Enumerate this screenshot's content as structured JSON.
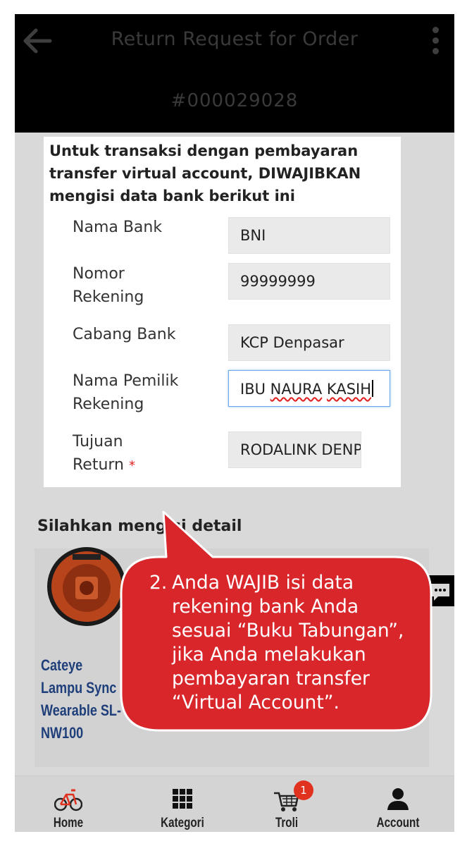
{
  "header": {
    "back_icon": "arrow-left-icon",
    "title": "Return Request for Order",
    "order_number": "#000029028",
    "menu_icon": "kebab-menu-icon"
  },
  "modal": {
    "notice": "Untuk transaksi dengan pembayaran transfer virtual account, DIWAJIBKAN mengisi data bank berikut ini",
    "fields": [
      {
        "label": "Nama Bank",
        "value": "BNI"
      },
      {
        "label": "Nomor Rekening",
        "value": "99999999"
      },
      {
        "label": "Cabang Bank",
        "value": "KCP Denpasar"
      },
      {
        "label": "Nama Pemilik Rekening",
        "value_word1": "IBU",
        "value_word2": "NAURA",
        "value_word3": "KASIH"
      },
      {
        "label": "Tujuan Return",
        "required_mark": "*",
        "value": "RODALINK DENPASAR"
      }
    ]
  },
  "background": {
    "detail_title": "Silahkan mengisi detail",
    "product_name": "Cateye Lampu Sync Wearable SL-NW100"
  },
  "callout": {
    "number": "2.",
    "text_line1": "Anda WAJIB isi data",
    "text_line2": "rekening bank Anda",
    "text_line3": "sesuai “Buku Tabungan”,",
    "text_line4": "jika Anda melakukan",
    "text_line5": "pembayaran transfer",
    "text_line6": "“Virtual Account”.",
    "color": "#d9262b"
  },
  "nav": {
    "items": [
      {
        "label": "Home",
        "icon": "bicycle-icon"
      },
      {
        "label": "Kategori",
        "icon": "grid-icon"
      },
      {
        "label": "Troli",
        "icon": "cart-icon",
        "badge": "1"
      },
      {
        "label": "Account",
        "icon": "user-icon"
      }
    ]
  }
}
